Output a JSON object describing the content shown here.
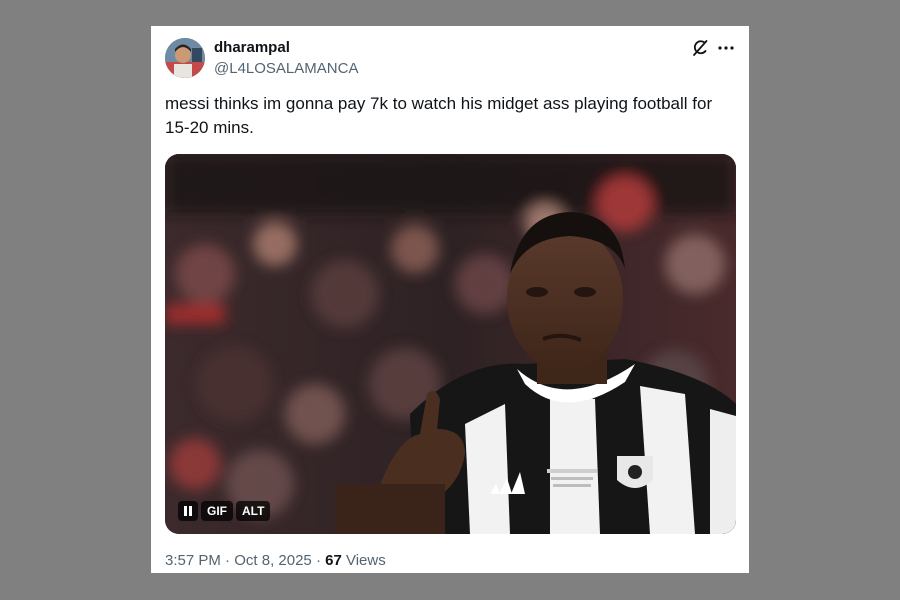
{
  "post": {
    "author": {
      "display_name": "dharampal",
      "handle": "@L4LOSALAMANCA"
    },
    "text_line1": "messi thinks im gonna pay 7k to watch his midget ass playing football for",
    "text_line2": "15-20 mins.",
    "media": {
      "type": "gif",
      "pause_icon": "pause-icon",
      "gif_label": "GIF",
      "alt_label": "ALT",
      "depicts_kit_text": "adidas"
    },
    "time": "3:57 PM",
    "separator": "·",
    "date": "Oct 8, 2025",
    "views_count": "67",
    "views_label": "Views"
  },
  "icons": {
    "grok": "grok-icon",
    "more": "more-options-icon"
  },
  "colors": {
    "page_background": "#808080",
    "card_background": "#ffffff",
    "primary_text": "#0f1419",
    "secondary_text": "#536471"
  }
}
